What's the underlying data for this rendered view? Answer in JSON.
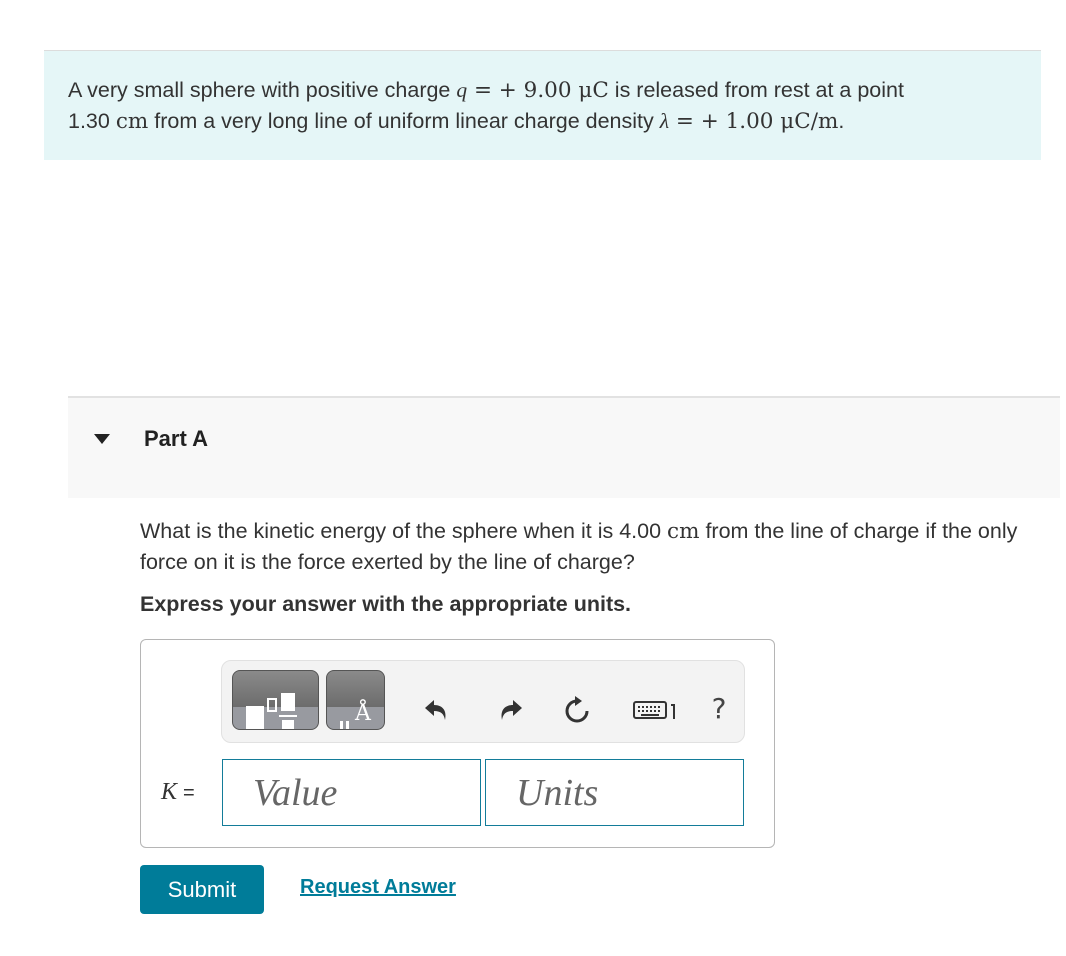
{
  "context": {
    "line1_a": "A very small sphere with positive charge ",
    "q_symbol": "q",
    "q_value": " = + 9.00 ",
    "q_unit": "μC",
    "line1_b": " is released from rest at a point",
    "dist_value": "1.30 ",
    "dist_unit": "cm",
    "line2_a": " from a very long line of uniform linear charge density ",
    "lambda_symbol": "λ",
    "lambda_value": " = + 1.00 ",
    "lambda_unit": "μC/m",
    "line2_end": "."
  },
  "part": {
    "title": "Part A",
    "expanded": true,
    "question_a": "What is the kinetic energy of the sphere when it is 4.00 ",
    "question_unit": "cm",
    "question_b": " from the line of charge if the only force on it is the force exerted by the line of charge?",
    "instruction": "Express your answer with the appropriate units."
  },
  "toolbar": {
    "templates_icon": "templates-icon",
    "units_icon": "units-angstrom-icon",
    "unit_glyph": "Å",
    "undo_icon": "undo-icon",
    "redo_icon": "redo-icon",
    "reset_icon": "reset-icon",
    "keyboard_icon": "keyboard-icon",
    "help_label": "?"
  },
  "answer": {
    "variable": "K",
    "equals": "=",
    "value_placeholder": "Value",
    "units_placeholder": "Units",
    "value": "",
    "units": ""
  },
  "actions": {
    "submit_label": "Submit",
    "request_answer_label": "Request Answer"
  },
  "colors": {
    "context_bg": "#e5f6f7",
    "part_header_bg": "#f8f8f8",
    "accent": "#007c99",
    "input_border": "#137c99"
  }
}
